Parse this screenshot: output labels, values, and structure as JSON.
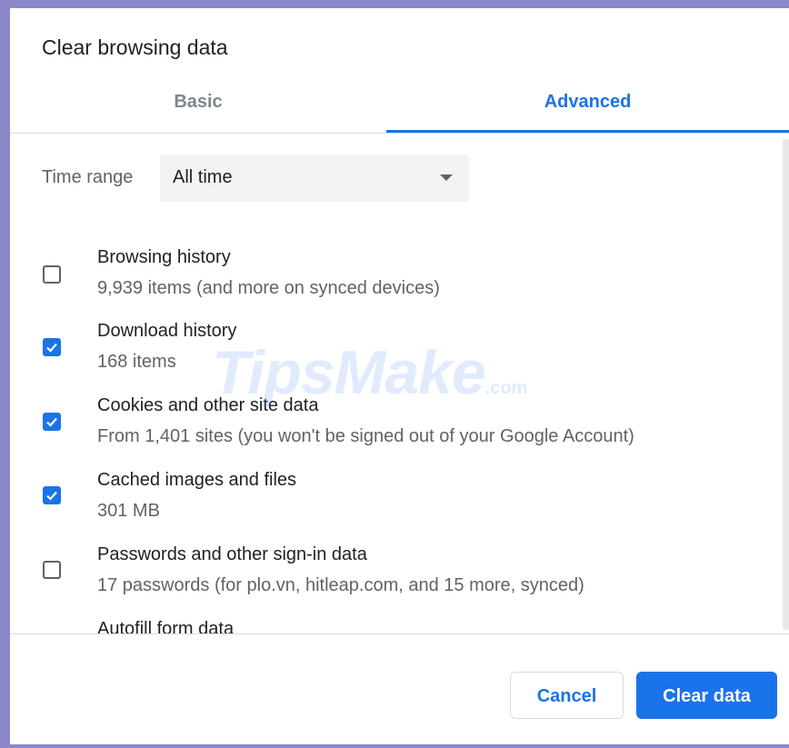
{
  "dialog": {
    "title": "Clear browsing data"
  },
  "tabs": [
    {
      "label": "Basic",
      "active": false
    },
    {
      "label": "Advanced",
      "active": true
    }
  ],
  "time_range": {
    "label": "Time range",
    "value": "All time"
  },
  "items": [
    {
      "title": "Browsing history",
      "subtitle": "9,939 items (and more on synced devices)",
      "checked": false
    },
    {
      "title": "Download history",
      "subtitle": "168 items",
      "checked": true
    },
    {
      "title": "Cookies and other site data",
      "subtitle": "From 1,401 sites (you won't be signed out of your Google Account)",
      "checked": true
    },
    {
      "title": "Cached images and files",
      "subtitle": "301 MB",
      "checked": true
    },
    {
      "title": "Passwords and other sign-in data",
      "subtitle": "17 passwords (for plo.vn, hitleap.com, and 15 more, synced)",
      "checked": false
    },
    {
      "title": "Autofill form data",
      "checked": false
    }
  ],
  "buttons": {
    "cancel": "Cancel",
    "clear": "Clear data"
  },
  "watermark": {
    "brand": "TipsMake",
    "suffix": ".com"
  },
  "colors": {
    "accent": "#1a73e8",
    "frame": "#8c87c8",
    "text_primary": "#202124",
    "text_secondary": "#5f6368"
  }
}
